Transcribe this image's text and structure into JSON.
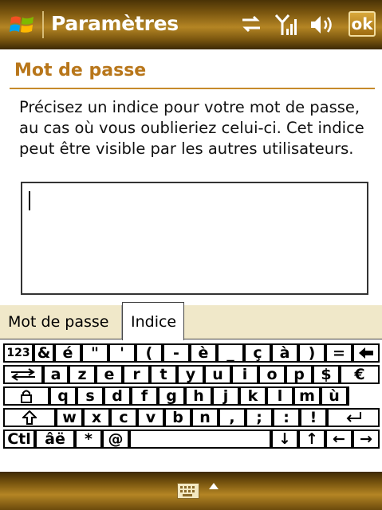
{
  "titlebar": {
    "title": "Paramètres",
    "ok_label": "ok",
    "icons": [
      "windows-start-icon",
      "sync-icon",
      "signal-icon",
      "volume-icon"
    ]
  },
  "page": {
    "header": "Mot de passe",
    "description": "Précisez un indice pour votre mot de passe, au cas où vous oublieriez celui-ci. Cet indice peut être visible par les autres utilisateurs.",
    "hint_value": ""
  },
  "tabs": [
    {
      "label": "Mot de passe",
      "active": false
    },
    {
      "label": "Indice",
      "active": true
    }
  ],
  "keyboard": {
    "row1": [
      "123",
      "&",
      "é",
      "\"",
      "'",
      "(",
      "-",
      "è",
      "_",
      "ç",
      "à",
      ")",
      "=",
      "←"
    ],
    "row2": [
      "tab",
      "a",
      "z",
      "e",
      "r",
      "t",
      "y",
      "u",
      "i",
      "o",
      "p",
      "$",
      "€"
    ],
    "row3": [
      "caps",
      "q",
      "s",
      "d",
      "f",
      "g",
      "h",
      "j",
      "k",
      "l",
      "m",
      "ù"
    ],
    "row4": [
      "shift",
      "w",
      "x",
      "c",
      "v",
      "b",
      "n",
      ",",
      ";",
      ":",
      "!",
      "enter"
    ],
    "row5": [
      "Ctl",
      "âë",
      "*",
      "@",
      " ",
      "↓",
      "↑",
      "←",
      "→"
    ]
  },
  "colors": {
    "accent": "#b8761a",
    "titlebar": "#7a560f",
    "tabbar": "#f0e8c9"
  },
  "bottombar": {
    "icons": [
      "keyboard-icon",
      "input-menu-arrow-icon"
    ]
  }
}
